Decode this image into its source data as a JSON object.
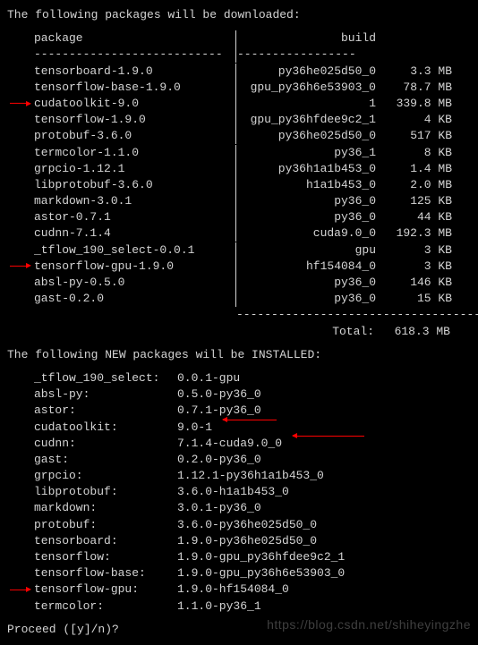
{
  "headings": {
    "download_heading": "The following packages will be downloaded:",
    "install_heading": "The following NEW packages will be INSTALLED:",
    "col_package": "package",
    "col_build": "build",
    "total_label": "Total:",
    "total_value": "618.3 MB",
    "proceed": "Proceed ([y]/n)?"
  },
  "downloads": [
    {
      "package": "tensorboard-1.9.0",
      "build": "py36he025d50_0",
      "size": "3.3 MB",
      "mark": false
    },
    {
      "package": "tensorflow-base-1.9.0",
      "build": "gpu_py36h6e53903_0",
      "size": "78.7 MB",
      "mark": false
    },
    {
      "package": "cudatoolkit-9.0",
      "build": "1",
      "size": "339.8 MB",
      "mark": true
    },
    {
      "package": "tensorflow-1.9.0",
      "build": "gpu_py36hfdee9c2_1",
      "size": "4 KB",
      "mark": false
    },
    {
      "package": "protobuf-3.6.0",
      "build": "py36he025d50_0",
      "size": "517 KB",
      "mark": false
    },
    {
      "package": "termcolor-1.1.0",
      "build": "py36_1",
      "size": "8 KB",
      "mark": false
    },
    {
      "package": "grpcio-1.12.1",
      "build": "py36h1a1b453_0",
      "size": "1.4 MB",
      "mark": false
    },
    {
      "package": "libprotobuf-3.6.0",
      "build": "h1a1b453_0",
      "size": "2.0 MB",
      "mark": false
    },
    {
      "package": "markdown-3.0.1",
      "build": "py36_0",
      "size": "125 KB",
      "mark": false
    },
    {
      "package": "astor-0.7.1",
      "build": "py36_0",
      "size": "44 KB",
      "mark": false
    },
    {
      "package": "cudnn-7.1.4",
      "build": "cuda9.0_0",
      "size": "192.3 MB",
      "mark": false
    },
    {
      "package": "_tflow_190_select-0.0.1",
      "build": "gpu",
      "size": "3 KB",
      "mark": false
    },
    {
      "package": "tensorflow-gpu-1.9.0",
      "build": "hf154084_0",
      "size": "3 KB",
      "mark": true
    },
    {
      "package": "absl-py-0.5.0",
      "build": "py36_0",
      "size": "146 KB",
      "mark": false
    },
    {
      "package": "gast-0.2.0",
      "build": "py36_0",
      "size": "15 KB",
      "mark": false
    }
  ],
  "installs": [
    {
      "name": "_tflow_190_select:",
      "ver": "0.0.1-gpu",
      "mark": false,
      "arrow_after": false
    },
    {
      "name": "absl-py:",
      "ver": "0.5.0-py36_0",
      "mark": false,
      "arrow_after": false
    },
    {
      "name": "astor:",
      "ver": "0.7.1-py36_0",
      "mark": false,
      "arrow_after": false
    },
    {
      "name": "cudatoolkit:",
      "ver": "9.0-1",
      "mark": false,
      "arrow_after": true,
      "arrow_width": 60
    },
    {
      "name": "cudnn:",
      "ver": "7.1.4-cuda9.0_0",
      "mark": false,
      "arrow_after": true,
      "arrow_width": 80
    },
    {
      "name": "gast:",
      "ver": "0.2.0-py36_0",
      "mark": false,
      "arrow_after": false
    },
    {
      "name": "grpcio:",
      "ver": "1.12.1-py36h1a1b453_0",
      "mark": false,
      "arrow_after": false
    },
    {
      "name": "libprotobuf:",
      "ver": "3.6.0-h1a1b453_0",
      "mark": false,
      "arrow_after": false
    },
    {
      "name": "markdown:",
      "ver": "3.0.1-py36_0",
      "mark": false,
      "arrow_after": false
    },
    {
      "name": "protobuf:",
      "ver": "3.6.0-py36he025d50_0",
      "mark": false,
      "arrow_after": false
    },
    {
      "name": "tensorboard:",
      "ver": "1.9.0-py36he025d50_0",
      "mark": false,
      "arrow_after": false
    },
    {
      "name": "tensorflow:",
      "ver": "1.9.0-gpu_py36hfdee9c2_1",
      "mark": false,
      "arrow_after": false
    },
    {
      "name": "tensorflow-base:",
      "ver": "1.9.0-gpu_py36h6e53903_0",
      "mark": false,
      "arrow_after": false
    },
    {
      "name": "tensorflow-gpu:",
      "ver": "1.9.0-hf154084_0",
      "mark": true,
      "arrow_after": false
    },
    {
      "name": "termcolor:",
      "ver": "1.1.0-py36_1",
      "mark": false,
      "arrow_after": false
    }
  ],
  "watermark": "https://blog.csdn.net/shiheyingzhe"
}
